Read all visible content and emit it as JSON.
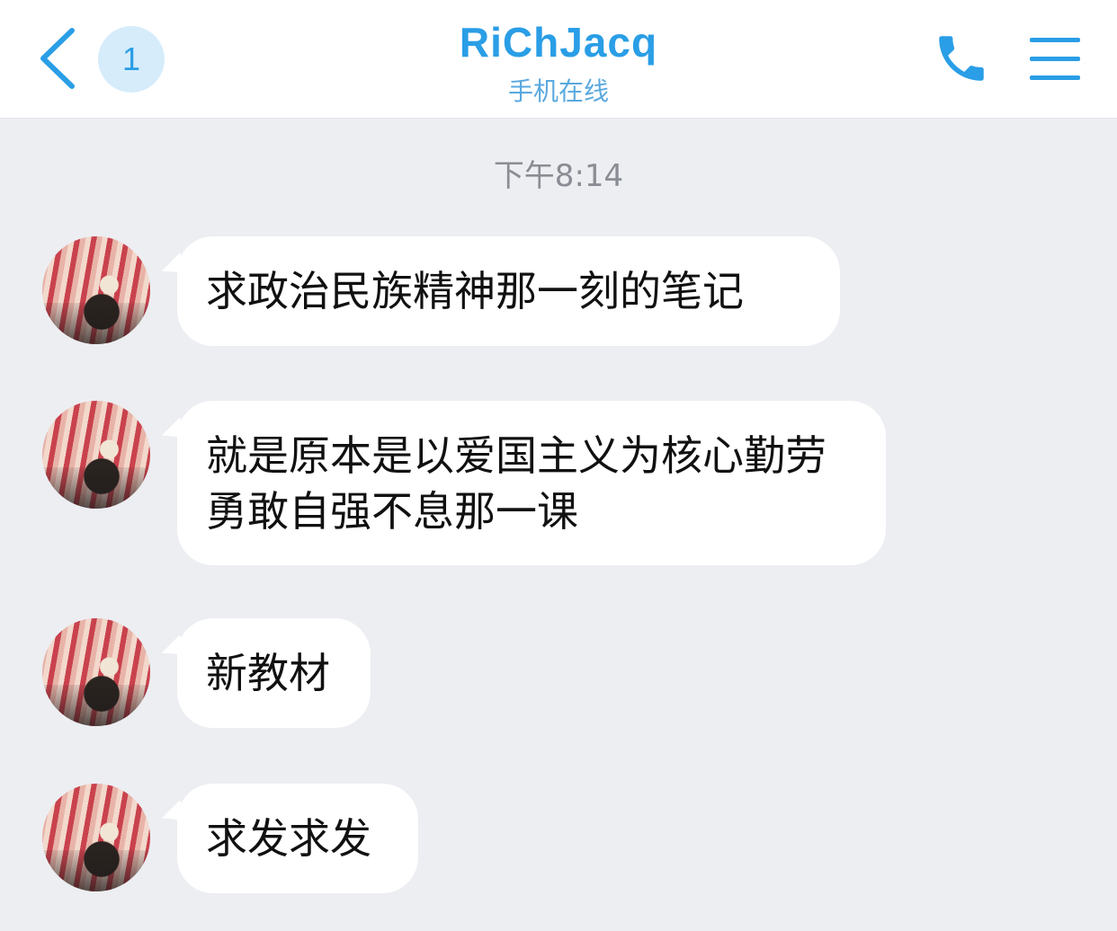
{
  "header": {
    "unread_count": "1",
    "title": "RiChJacq",
    "subtitle": "手机在线"
  },
  "icons": {
    "back": "chevron-left-icon",
    "phone": "phone-icon",
    "menu": "menu-icon"
  },
  "colors": {
    "accent": "#2a9ee6",
    "background": "#eceef2",
    "bubble": "#ffffff"
  },
  "chat": {
    "timestamp": "下午8:14",
    "messages": [
      {
        "text": "求政治民族精神那一刻的笔记"
      },
      {
        "text": "就是原本是以爱国主义为核心勤劳勇敢自强不息那一课"
      },
      {
        "text": "新教材"
      },
      {
        "text": "求发求发"
      }
    ]
  }
}
